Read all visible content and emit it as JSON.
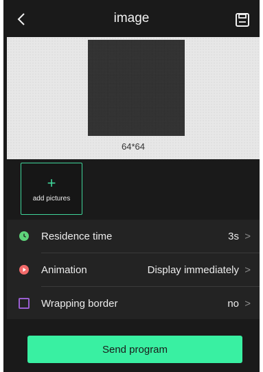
{
  "header": {
    "title": "image",
    "back_icon": "chevron-left-icon",
    "save_icon": "save-icon"
  },
  "preview": {
    "dimensions": "64*64"
  },
  "add_tile": {
    "plus": "+",
    "label": "add pictures"
  },
  "settings": [
    {
      "label": "Residence time",
      "value": "3s",
      "icon": "clock-icon",
      "icon_color": "#5ed47a"
    },
    {
      "label": "Animation",
      "value": "Display immediately",
      "icon": "play-icon",
      "icon_color": "#f26a6a"
    },
    {
      "label": "Wrapping border",
      "value": "no",
      "icon": "border-icon",
      "icon_color": "#9a5fd1"
    }
  ],
  "chevron_right": ">",
  "send_button": {
    "label": "Send program",
    "color": "#39f0a2"
  },
  "accent_color": "#3fd69a"
}
